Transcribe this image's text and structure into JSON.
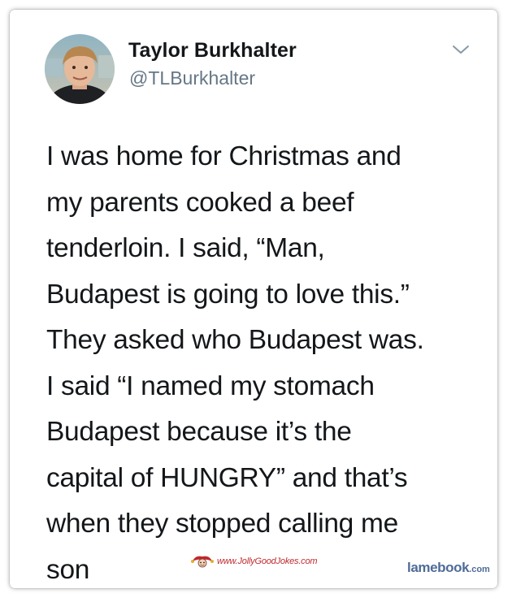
{
  "tweet": {
    "author_name": "Taylor Burkhalter",
    "author_handle": "@TLBurkhalter",
    "text": "I was home for Christmas and\nmy parents cooked a beef\ntenderloin. I said, “Man,\nBudapest is going to love this.”\nThey asked who Budapest was.\nI said “I named my stomach\nBudapest because it’s the\ncapital of HUNGRY” and that’s\nwhen they stopped calling me\nson"
  },
  "icons": {
    "menu": "chevron-down-icon",
    "avatar": "profile-photo"
  },
  "watermarks": {
    "jolly": "www.JollyGoodJokes.com",
    "lamebook_main": "lamebook",
    "lamebook_tld": ".com"
  },
  "colors": {
    "text": "#14171a",
    "secondary": "#657786",
    "jolly_red": "#c0282d",
    "lamebook_blue": "#4f6b98"
  }
}
